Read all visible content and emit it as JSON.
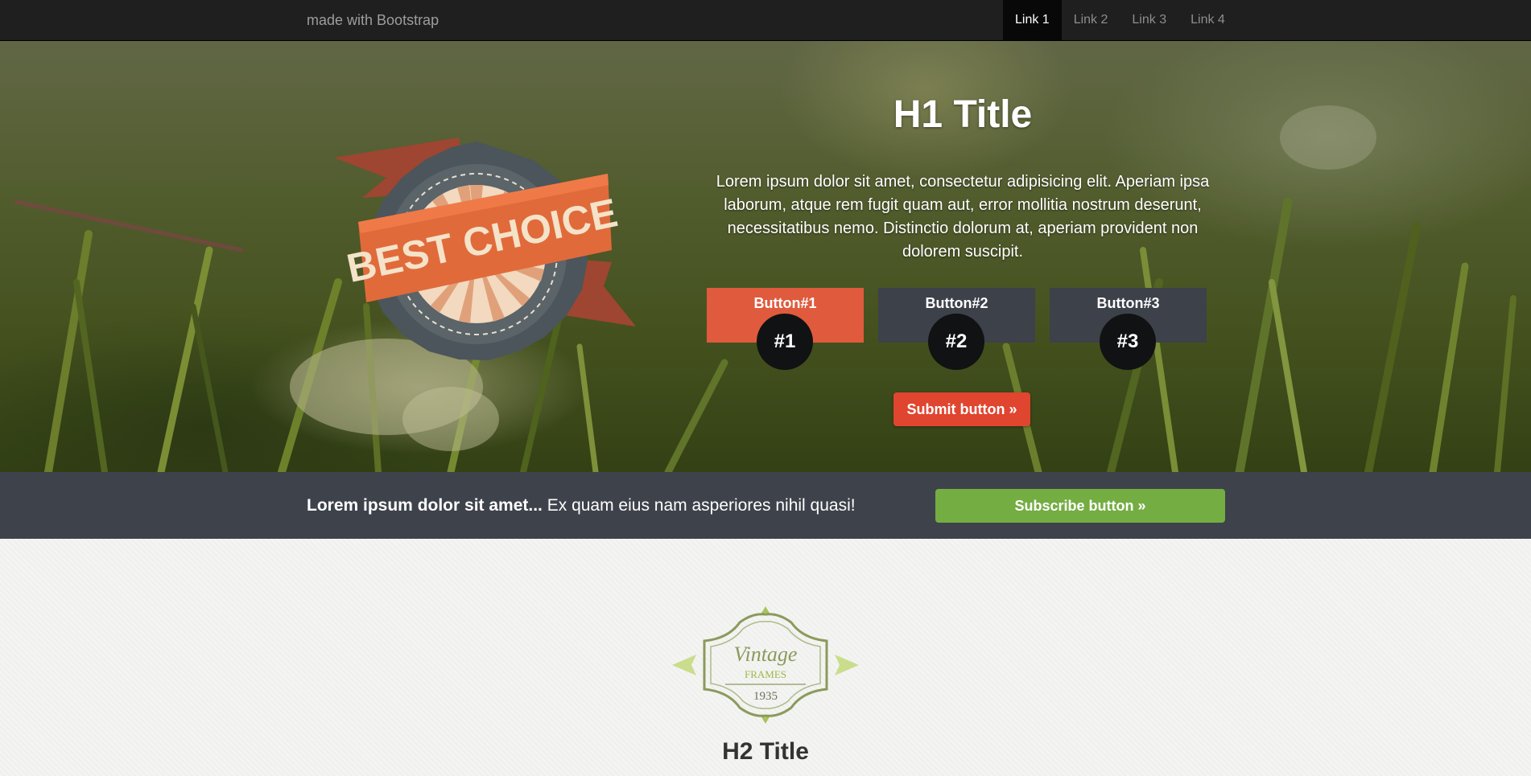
{
  "navbar": {
    "brand": "made with Bootstrap",
    "links": [
      {
        "label": "Link 1",
        "active": true
      },
      {
        "label": "Link 2",
        "active": false
      },
      {
        "label": "Link 3",
        "active": false
      },
      {
        "label": "Link 4",
        "active": false
      }
    ]
  },
  "hero": {
    "badge_text": "BEST CHOICE",
    "title": "H1 Title",
    "lead": "Lorem ipsum dolor sit amet, consectetur adipisicing elit. Aperiam ipsa laborum, atque rem fugit quam aut, error mollitia nostrum deserunt, necessitatibus nemo. Distinctio dolorum at, aperiam provident non dolorem suscipit.",
    "features": [
      {
        "label": "Button#1",
        "number": "#1"
      },
      {
        "label": "Button#2",
        "number": "#2"
      },
      {
        "label": "Button#3",
        "number": "#3"
      }
    ],
    "submit_label": "Submit button »"
  },
  "strip": {
    "bold_text": "Lorem ipsum dolor sit amet...",
    "text": " Ex quam eius nam asperiores nihil quasi!",
    "subscribe_label": "Subscribe button »"
  },
  "lower": {
    "logo": {
      "line1": "Vintage",
      "line2": "FRAMES",
      "year": "1935"
    },
    "title": "H2 Title"
  },
  "colors": {
    "accent_red": "#e05a3d",
    "submit_red": "#e0452f",
    "feature_dark": "#3d414a",
    "strip_bg": "#3e424b",
    "subscribe_green": "#74ad42",
    "navbar_bg": "#1f1f1f"
  }
}
